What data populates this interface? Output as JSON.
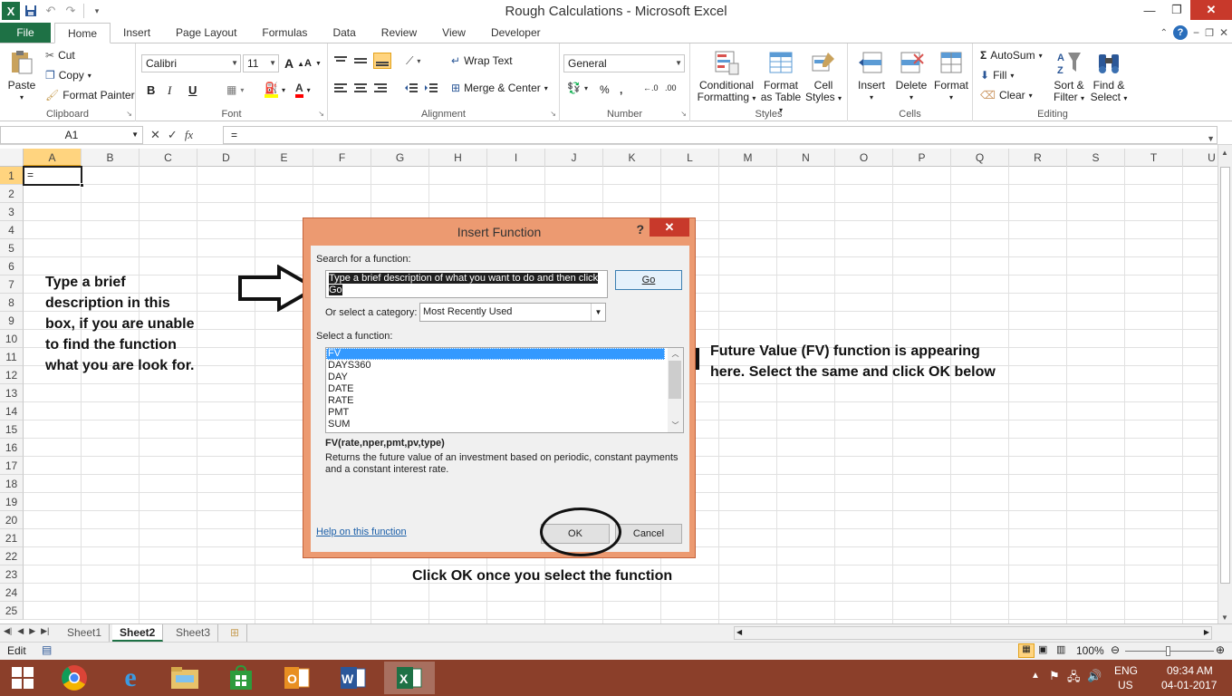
{
  "window": {
    "title": "Rough Calculations  -  Microsoft Excel"
  },
  "qat": {
    "logo": "X"
  },
  "tabs": [
    "File",
    "Home",
    "Insert",
    "Page Layout",
    "Formulas",
    "Data",
    "Review",
    "View",
    "Developer"
  ],
  "ribbon": {
    "clipboard": {
      "paste": "Paste",
      "cut": "Cut",
      "copy": "Copy",
      "format_painter": "Format Painter",
      "label": "Clipboard"
    },
    "font": {
      "name": "Calibri",
      "size": "11",
      "bold": "B",
      "italic": "I",
      "underline": "U",
      "label": "Font"
    },
    "alignment": {
      "wrap_text": "Wrap Text",
      "merge_center": "Merge & Center",
      "label": "Alignment"
    },
    "number": {
      "format": "General",
      "percent": "%",
      "comma": ",",
      "label": "Number"
    },
    "styles": {
      "conditional": "Conditional",
      "conditional2": "Formatting",
      "format_as": "Format",
      "format_as2": "as Table",
      "cell": "Cell",
      "cell2": "Styles",
      "label": "Styles"
    },
    "cells": {
      "insert": "Insert",
      "delete": "Delete",
      "format": "Format",
      "label": "Cells"
    },
    "editing": {
      "autosum": "AutoSum",
      "fill": "Fill",
      "clear": "Clear",
      "sort": "Sort &",
      "sort2": "Filter",
      "find": "Find &",
      "find2": "Select",
      "label": "Editing"
    }
  },
  "formula_bar": {
    "name_box": "A1",
    "fx": "fx",
    "value": "="
  },
  "grid": {
    "columns": [
      "A",
      "B",
      "C",
      "D",
      "E",
      "F",
      "G",
      "H",
      "I",
      "J",
      "K",
      "L",
      "M",
      "N",
      "O",
      "P",
      "Q",
      "R",
      "S",
      "T",
      "U"
    ],
    "rows": [
      "1",
      "2",
      "3",
      "4",
      "5",
      "6",
      "7",
      "8",
      "9",
      "10",
      "11",
      "12",
      "13",
      "14",
      "15",
      "16",
      "17",
      "18",
      "19",
      "20",
      "21",
      "22",
      "23",
      "24",
      "25"
    ],
    "active_value": "="
  },
  "sheets": [
    "Sheet1",
    "Sheet2",
    "Sheet3"
  ],
  "status": {
    "mode": "Edit",
    "zoom": "100%"
  },
  "taskbar": {
    "lang1": "ENG",
    "lang2": "US",
    "time": "09:34 AM",
    "date": "04-01-2017"
  },
  "dialog": {
    "title": "Insert Function",
    "help": "?",
    "close": "✕",
    "search_label": "Search for a function:",
    "search_value_1": "Type a brief description of what you want to do and then click",
    "search_value_2": "Go",
    "go": "Go",
    "category_label": "Or select a category:",
    "category_value": "Most Recently Used",
    "select_label": "Select a function:",
    "functions": [
      "FV",
      "DAYS360",
      "DAY",
      "DATE",
      "RATE",
      "PMT",
      "SUM"
    ],
    "signature": "FV(rate,nper,pmt,pv,type)",
    "description": "Returns the future value of an investment based on periodic, constant payments and a constant interest rate.",
    "help_link": "Help on this function",
    "ok": "OK",
    "cancel": "Cancel"
  },
  "annotations": {
    "left_1": "Type a brief",
    "left_2": "description in this",
    "left_3": "box, if you are unable",
    "left_4": "to find the function",
    "left_5": "what you are look for.",
    "right_1": "Future Value (FV) function is appearing",
    "right_2": "here. Select the same and click OK below",
    "bottom": "Click OK once you select the function"
  }
}
